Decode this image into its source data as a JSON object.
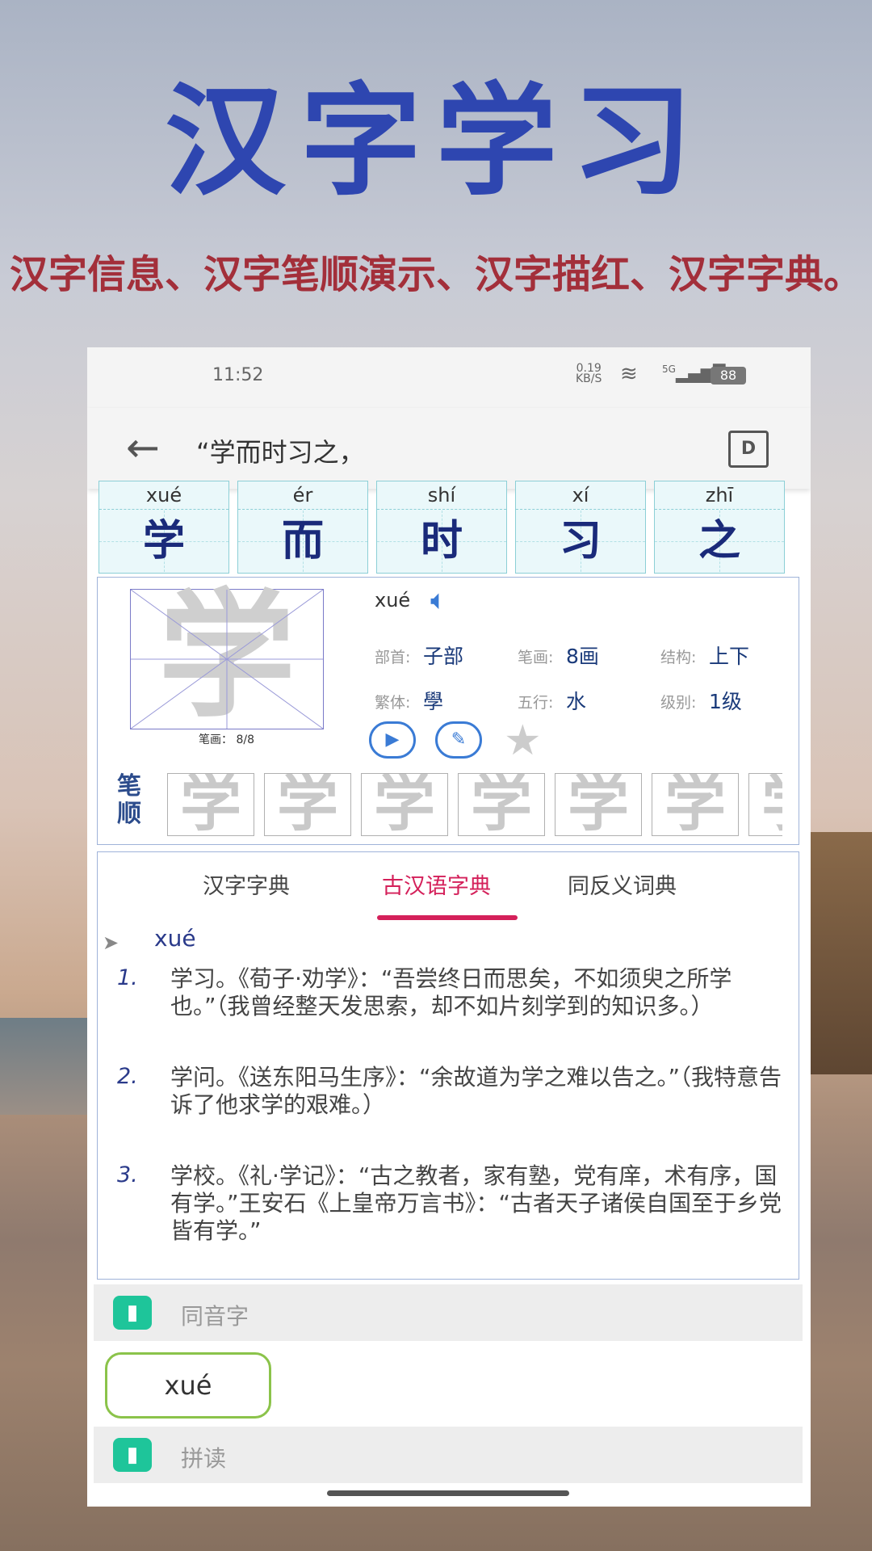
{
  "hero": {
    "title": "汉字学习",
    "subtitle": "汉字信息、汉字笔顺演示、汉字描红、汉字字典。"
  },
  "statusbar": {
    "time": "11:52",
    "net_speed": "0.19",
    "net_unit": "KB/S",
    "signal": "5G",
    "battery": "88"
  },
  "appbar": {
    "back_icon": "arrow-left-icon",
    "title": "“学而时习之，",
    "doc_icon": "document-icon",
    "doc_glyph": "D"
  },
  "char_cells": [
    {
      "pinyin": "xué",
      "hanzi": "学"
    },
    {
      "pinyin": "ér",
      "hanzi": "而"
    },
    {
      "pinyin": "shí",
      "hanzi": "时"
    },
    {
      "pinyin": "xí",
      "hanzi": "习"
    },
    {
      "pinyin": "zhī",
      "hanzi": "之"
    }
  ],
  "info": {
    "char": "学",
    "stroke_progress": "笔画： 8/8",
    "pinyin": "xué",
    "speaker_icon": "speaker-icon",
    "radical_label": "部首:",
    "radical_value": "子部",
    "strokes_label": "笔画:",
    "strokes_value": "8画",
    "structure_label": "结构:",
    "structure_value": "上下",
    "traditional_label": "繁体:",
    "traditional_value": "學",
    "wuxing_label": "五行:",
    "wuxing_value": "水",
    "level_label": "级别:",
    "level_value": "1级",
    "play_icon": "play-icon",
    "edit_icon": "pencil-icon",
    "star_icon": "star-icon",
    "bishun_label": "笔顺",
    "stroke_frames": [
      "学",
      "学",
      "学",
      "学",
      "学",
      "学",
      "学"
    ]
  },
  "dict": {
    "tabs": [
      "汉字字典",
      "古汉语字典",
      "同反义词典"
    ],
    "active_tab": "古汉语字典",
    "pinyin": "xué",
    "definitions": [
      {
        "num": "1.",
        "text": "学习。《荀子·劝学》：“吾尝终日而思矣，不如须臾之所学也。”（我曾经整天发思索，却不如片刻学到的知识多。）"
      },
      {
        "num": "2.",
        "text": "学问。《送东阳马生序》：“余故道为学之难以告之。”（我特意告诉了他求学的艰难。）"
      },
      {
        "num": "3.",
        "text": "学校。《礼·学记》：“古之教者，家有塾，党有庠，术有序，国有学。”王安石《上皇帝万言书》：“古者天子诸侯自国至于乡党皆有学。”"
      }
    ]
  },
  "sections": {
    "homophones_label": "同音字",
    "homophone_chip": "xué",
    "pindu_label": "拼读",
    "bookmark_icon": "bookmark-icon",
    "accent": "#1ec59a"
  }
}
